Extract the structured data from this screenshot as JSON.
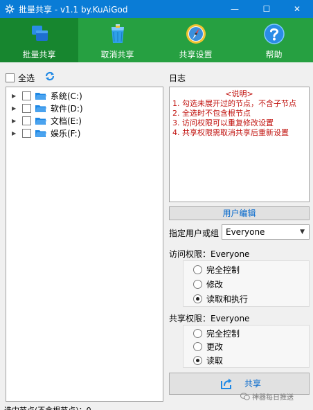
{
  "window": {
    "title": "批量共享 - v1.1 by.KuAiGod",
    "minimize_symbol": "—",
    "maximize_symbol": "☐",
    "close_symbol": "✕"
  },
  "toolbar": {
    "items": [
      {
        "label": "批量共享",
        "icon": "windows-share-icon",
        "active": true
      },
      {
        "label": "取消共享",
        "icon": "trash-icon",
        "active": false
      },
      {
        "label": "共享设置",
        "icon": "compass-icon",
        "active": false
      },
      {
        "label": "帮助",
        "icon": "help-icon",
        "active": false
      }
    ]
  },
  "tree": {
    "select_all_label": "全选",
    "items": [
      {
        "label": "系统(C:)"
      },
      {
        "label": "软件(D:)"
      },
      {
        "label": "文档(E:)"
      },
      {
        "label": "娱乐(F:)"
      }
    ]
  },
  "log": {
    "label": "日志",
    "heading": "<说明>",
    "lines": [
      "1. 勾选未展开过的节点，不含子节点",
      "2. 全选时不包含根节点",
      "3. 访问权限可以重复修改设置",
      "4. 共享权限需取消共享后重新设置"
    ]
  },
  "user": {
    "edit_button": "用户编辑",
    "select_label": "指定用户或组",
    "selected": "Everyone"
  },
  "access": {
    "label": "访问权限：Everyone",
    "options": [
      "完全控制",
      "修改",
      "读取和执行"
    ],
    "selected_index": 2
  },
  "share_perm": {
    "label": "共享权限：Everyone",
    "options": [
      "完全控制",
      "更改",
      "读取"
    ],
    "selected_index": 2
  },
  "share_button": "共享",
  "status": "选中节点(不含根节点)：0",
  "watermark": "神器每日推送",
  "colors": {
    "titlebar": "#0a7cd6",
    "toolbar": "#26a041",
    "toolbar_active": "#17862f",
    "log_text": "#c0100c",
    "link_blue": "#0066cc"
  }
}
